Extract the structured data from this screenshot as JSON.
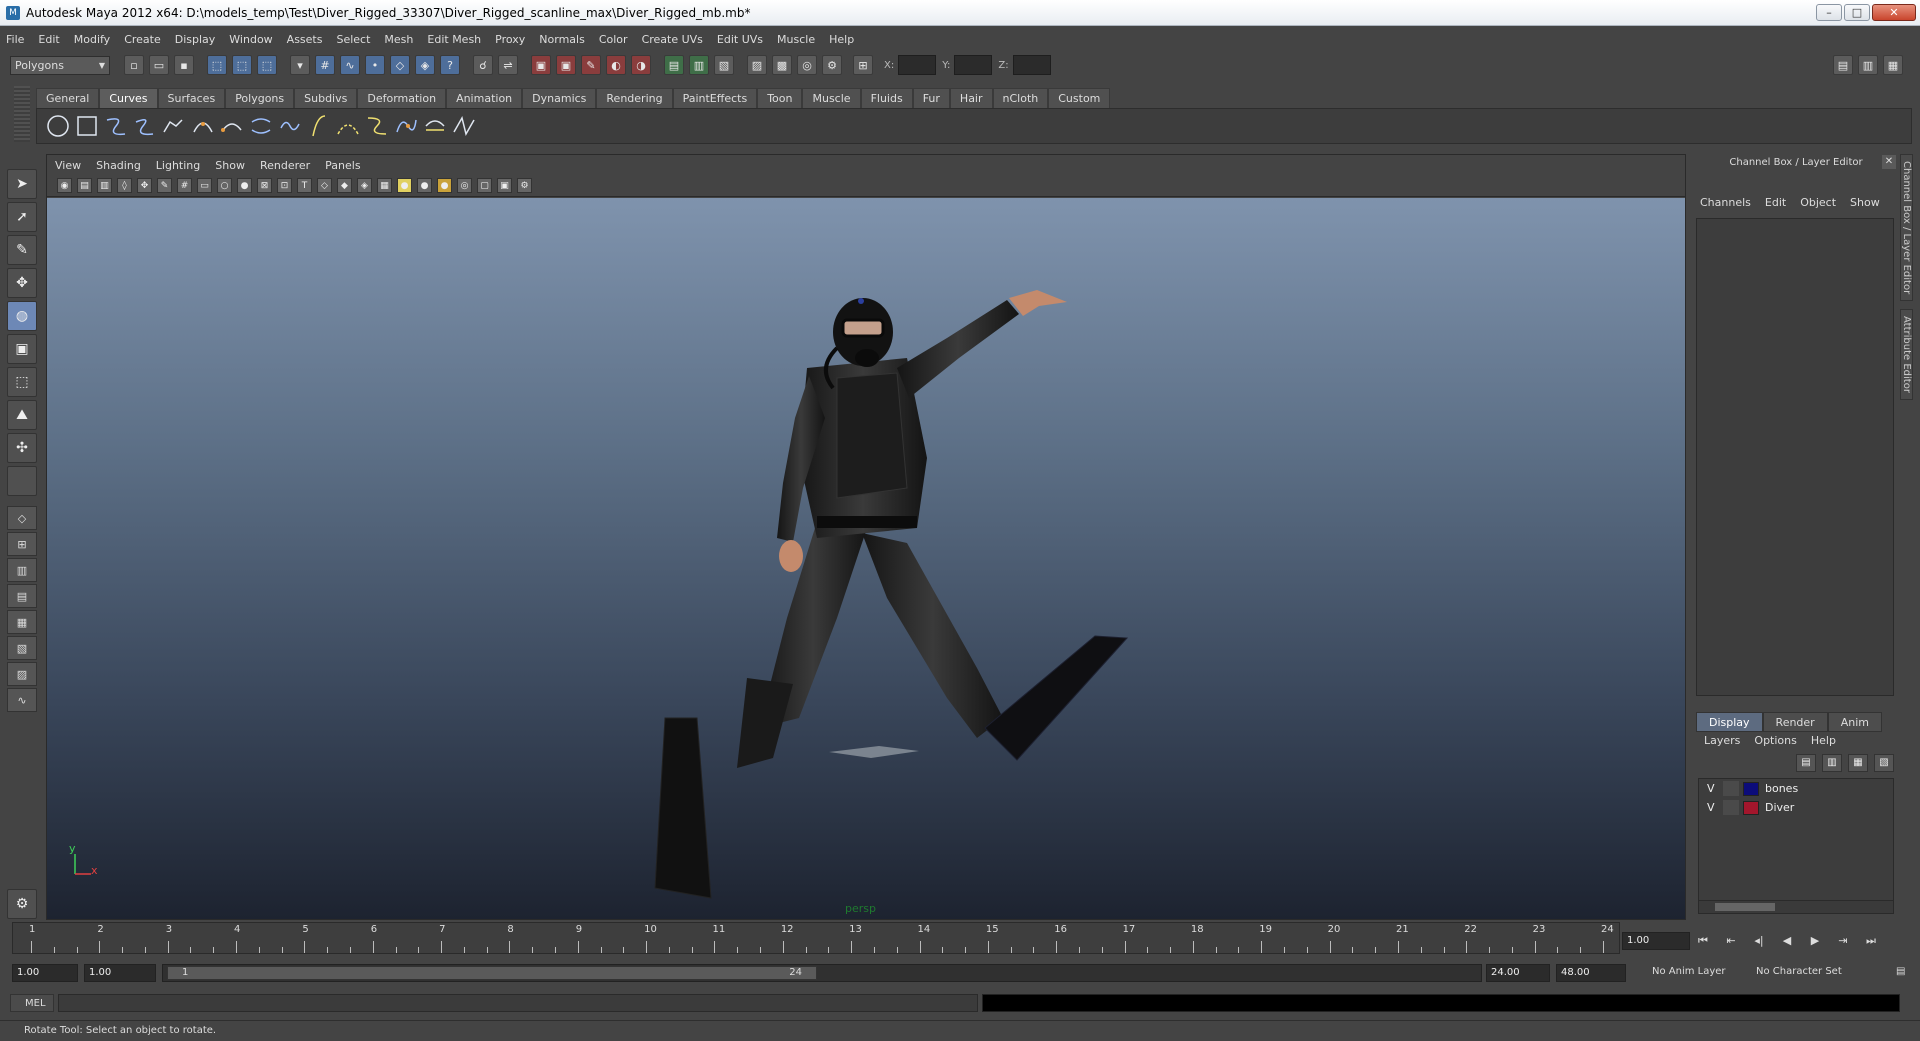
{
  "window": {
    "title": "Autodesk Maya 2012 x64: D:\\models_temp\\Test\\Diver_Rigged_33307\\Diver_Rigged_scanline_max\\Diver_Rigged_mb.mb*"
  },
  "menubar": [
    "File",
    "Edit",
    "Modify",
    "Create",
    "Display",
    "Window",
    "Assets",
    "Select",
    "Mesh",
    "Edit Mesh",
    "Proxy",
    "Normals",
    "Color",
    "Create UVs",
    "Edit UVs",
    "Muscle",
    "Help"
  ],
  "statusline": {
    "mode": "Polygons",
    "x_label": "X:",
    "y_label": "Y:",
    "z_label": "Z:"
  },
  "shelf": {
    "tabs": [
      "General",
      "Curves",
      "Surfaces",
      "Polygons",
      "Subdivs",
      "Deformation",
      "Animation",
      "Dynamics",
      "Rendering",
      "PaintEffects",
      "Toon",
      "Muscle",
      "Fluids",
      "Fur",
      "Hair",
      "nCloth",
      "Custom"
    ],
    "active_tab": "Curves",
    "icons": [
      "circle-curve-icon",
      "square-curve-icon",
      "cv-curve-icon",
      "ep-curve-icon",
      "pencil-curve-icon",
      "arc-three-point-icon",
      "arc-two-point-icon",
      "attach-curves-icon",
      "detach-curves-icon",
      "insert-knot-icon",
      "extend-curve-icon",
      "offset-curve-icon",
      "rebuild-curve-icon",
      "reverse-curve-icon",
      "bezier-curve-icon"
    ]
  },
  "toolbox": {
    "tools": [
      "select-tool-icon",
      "lasso-tool-icon",
      "paint-select-tool-icon",
      "move-tool-icon",
      "rotate-tool-icon",
      "scale-tool-icon",
      "universal-manipulator-icon",
      "soft-modification-icon",
      "show-manipulator-icon",
      "last-tool-icon"
    ],
    "layouts": [
      "single-perspective-layout-icon",
      "four-view-layout-icon",
      "persp-outliner-layout-icon",
      "persp-graph-layout-icon",
      "hypershade-layout-icon",
      "persp-graph-hypershade-icon",
      "persp-uv-layout-icon",
      "graph-editor-layout-icon"
    ]
  },
  "viewport": {
    "menu": [
      "View",
      "Shading",
      "Lighting",
      "Show",
      "Renderer",
      "Panels"
    ],
    "camera_label": "persp",
    "axis_y": "y",
    "axis_x": "x"
  },
  "rightpanel": {
    "title": "Channel Box / Layer Editor",
    "menu": [
      "Channels",
      "Edit",
      "Object",
      "Show"
    ],
    "tabs": [
      "Display",
      "Render",
      "Anim"
    ],
    "active_tab": "Display",
    "layer_menu": [
      "Layers",
      "Options",
      "Help"
    ],
    "layers": [
      {
        "visible": "V",
        "name": "bones",
        "color": "#0c0c7a"
      },
      {
        "visible": "V",
        "name": "Diver",
        "color": "#a3162c"
      }
    ],
    "side_tabs": [
      "Channel Box / Layer Editor",
      "Attribute Editor"
    ]
  },
  "timeline": {
    "ticks": [
      "1",
      "2",
      "3",
      "4",
      "5",
      "6",
      "7",
      "8",
      "9",
      "10",
      "11",
      "12",
      "13",
      "14",
      "15",
      "16",
      "17",
      "18",
      "19",
      "20",
      "21",
      "22",
      "23",
      "24"
    ],
    "current_frame": "1.00"
  },
  "range": {
    "start_time": "1.00",
    "playback_start": "1.00",
    "range_start_label": "1",
    "range_end_label": "24",
    "playback_end": "24.00",
    "end_time": "48.00",
    "anim_layer": "No Anim Layer",
    "character_set": "No Character Set"
  },
  "command_line": {
    "lang": "MEL"
  },
  "help_line": "Rotate Tool: Select an object to rotate."
}
